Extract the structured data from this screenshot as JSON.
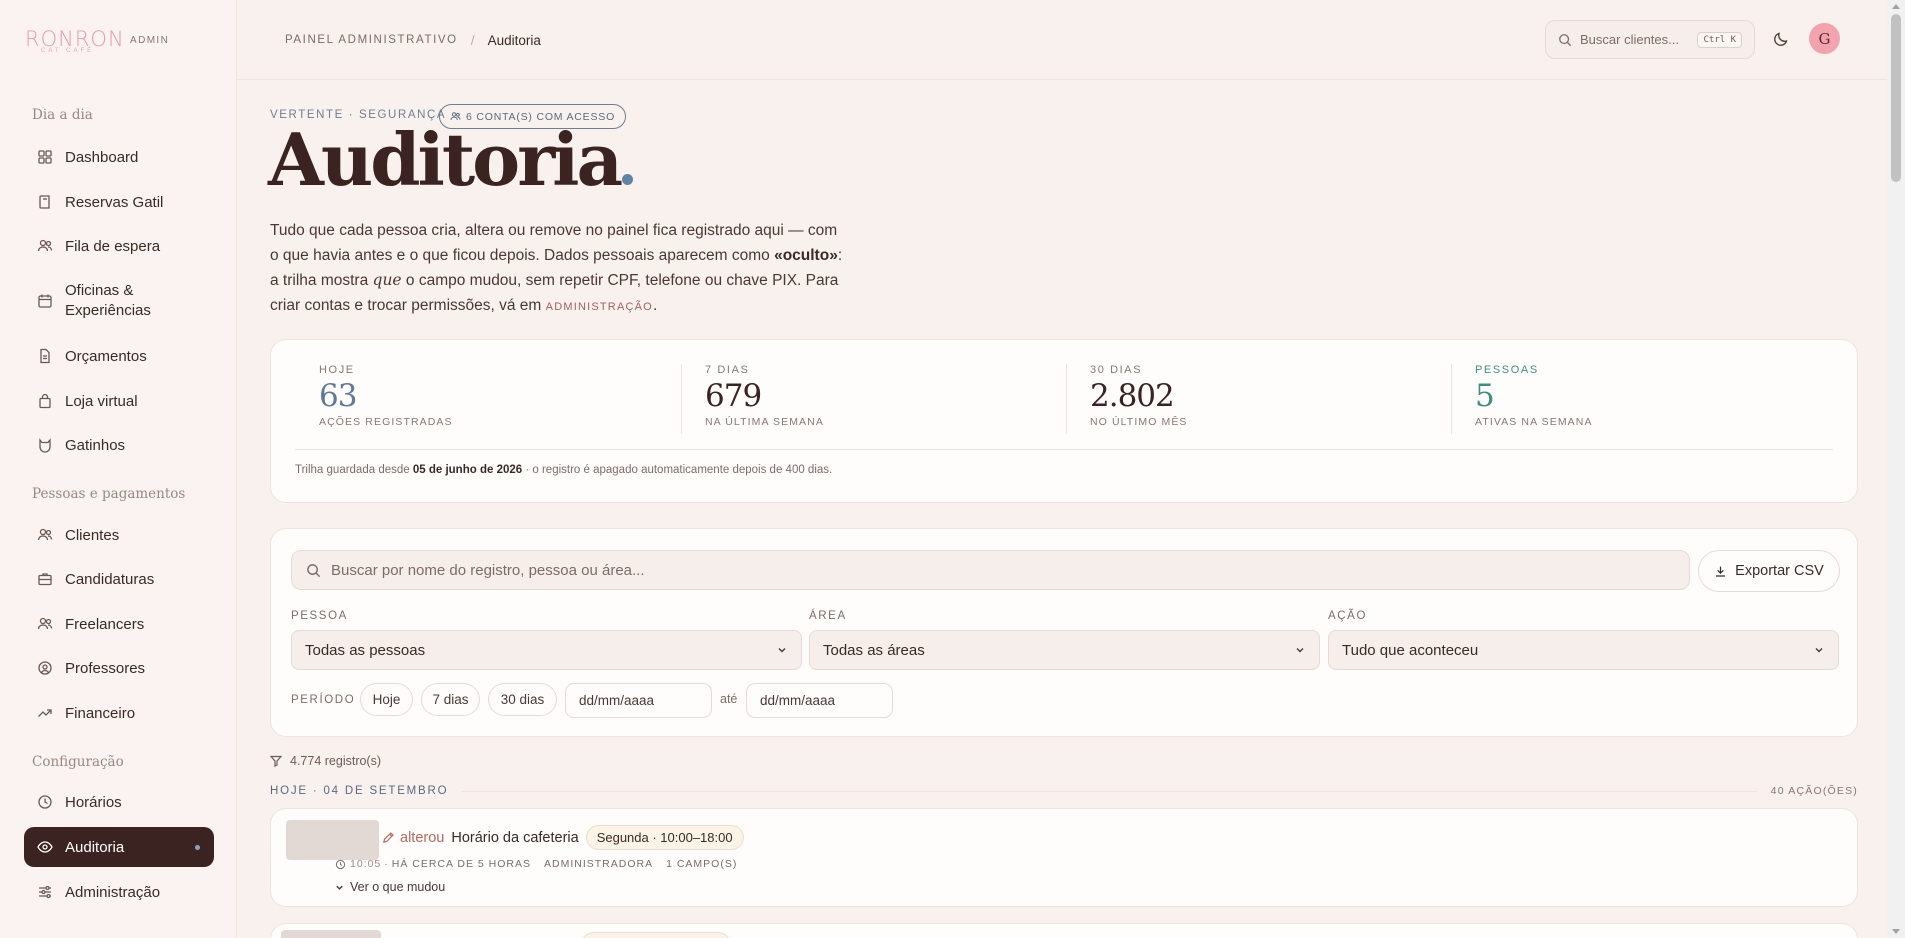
{
  "brand": {
    "name": "RONRON",
    "tagline": "CAT CAFÉ",
    "badge": "ADMIN"
  },
  "sidebar": {
    "sections": [
      {
        "title": "Dia a dia",
        "items": [
          {
            "label": "Dashboard",
            "icon": "grid-icon"
          },
          {
            "label": "Reservas Gatil",
            "icon": "book-icon"
          },
          {
            "label": "Fila de espera",
            "icon": "users-icon"
          },
          {
            "label": "Oficinas & Experiências",
            "icon": "calendar-icon"
          },
          {
            "label": "Orçamentos",
            "icon": "file-icon"
          },
          {
            "label": "Loja virtual",
            "icon": "bag-icon"
          },
          {
            "label": "Gatinhos",
            "icon": "cat-icon"
          }
        ]
      },
      {
        "title": "Pessoas e pagamentos",
        "items": [
          {
            "label": "Clientes",
            "icon": "users-icon"
          },
          {
            "label": "Candidaturas",
            "icon": "briefcase-icon"
          },
          {
            "label": "Freelancers",
            "icon": "users-icon"
          },
          {
            "label": "Professores",
            "icon": "badge-icon"
          },
          {
            "label": "Financeiro",
            "icon": "trend-icon"
          }
        ]
      },
      {
        "title": "Configuração",
        "items": [
          {
            "label": "Horários",
            "icon": "clock-icon"
          },
          {
            "label": "Auditoria",
            "icon": "eye-icon",
            "active": true
          },
          {
            "label": "Administração",
            "icon": "sliders-icon"
          }
        ]
      }
    ]
  },
  "topbar": {
    "breadcrumb_root": "PAINEL ADMINISTRATIVO",
    "breadcrumb_sep": "/",
    "breadcrumb_current": "Auditoria",
    "search_placeholder": "Buscar clientes...",
    "shortcut": "Ctrl K",
    "avatar_initial": "G"
  },
  "header": {
    "eyebrow": "VERTENTE · SEGURANÇA",
    "access_pill": "6 CONTA(S) COM ACESSO",
    "title": "Auditoria",
    "intro_1": "Tudo que cada pessoa cria, altera ou remove no painel fica registrado aqui — com o que havia antes e o que ficou depois. Dados pessoais aparecem como ",
    "intro_bold": "«oculto»",
    "intro_2": ": a trilha mostra ",
    "intro_italic": "que",
    "intro_3": " o campo mudou, sem repetir CPF, telefone ou chave PIX. Para criar contas e trocar permissões, vá em ",
    "intro_link": "ADMINISTRAÇÃO",
    "intro_end": "."
  },
  "stats": {
    "items": [
      {
        "label": "HOJE",
        "value": "63",
        "sub": "AÇÕES REGISTRADAS",
        "color": "#5d7a9a"
      },
      {
        "label": "7 DIAS",
        "value": "679",
        "sub": "NA ÚLTIMA SEMANA",
        "color": "#3b2321"
      },
      {
        "label": "30 DIAS",
        "value": "2.802",
        "sub": "NO ÚLTIMO MÊS",
        "color": "#3b2321"
      },
      {
        "label": "PESSOAS",
        "value": "5",
        "sub": "ATIVAS NA SEMANA",
        "color": "#3e8f7e"
      }
    ],
    "footer_1": "Trilha guardada desde ",
    "footer_bold": "05 de junho de 2026",
    "footer_2": " · o registro é apagado automaticamente depois de 400 dias."
  },
  "filters": {
    "search_placeholder": "Buscar por nome do registro, pessoa ou área...",
    "export_label": "Exportar CSV",
    "person_label": "PESSOA",
    "person_value": "Todas as pessoas",
    "area_label": "ÁREA",
    "area_value": "Todas as áreas",
    "action_label": "AÇÃO",
    "action_value": "Tudo que aconteceu",
    "period_label": "PERÍODO",
    "chips": [
      "Hoje",
      "7 dias",
      "30 dias"
    ],
    "date_from": "dd/mm/aaaa",
    "date_sep": "até",
    "date_to": "dd/mm/aaaa"
  },
  "results": {
    "count": "4.774 registro(s)",
    "day_label": "HOJE · 04 DE SETEMBRO",
    "day_count": "40 AÇÃO(ÕES)",
    "entries": [
      {
        "verb": "alterou",
        "subject": "Horário da cafeteria",
        "value": "Segunda · 10:00–18:00",
        "time": "10:05",
        "ago": "HÁ CERCA DE 5 HORAS",
        "role": "ADMINISTRADORA",
        "fields": "1 CAMPO(S)",
        "toggle": "Ver o que mudou"
      }
    ]
  },
  "colors": {
    "accent": "#3b2321",
    "brand_pink": "#e79aab",
    "verb": "#b4685f",
    "link_blue": "#5d84a4"
  }
}
